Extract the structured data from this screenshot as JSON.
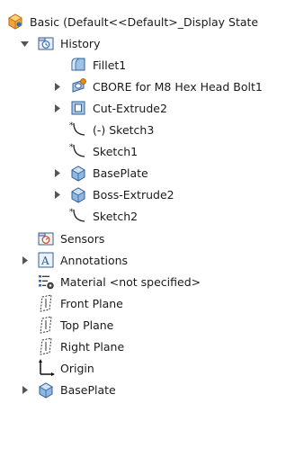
{
  "tree": {
    "root": {
      "label": "Basic  (Default<<Default>_Display State",
      "icon": "part-icon"
    },
    "history": {
      "label": "History",
      "icon": "history-folder-icon",
      "expanded": true,
      "items": [
        {
          "label": "Fillet1",
          "icon": "fillet-icon",
          "has_children": false
        },
        {
          "label": "CBORE for M8 Hex Head Bolt1",
          "icon": "hole-wizard-icon",
          "has_children": true
        },
        {
          "label": "Cut-Extrude2",
          "icon": "cut-extrude-icon",
          "has_children": true
        },
        {
          "label": "(-) Sketch3",
          "icon": "sketch-icon",
          "has_children": false
        },
        {
          "label": "Sketch1",
          "icon": "sketch-icon",
          "has_children": false
        },
        {
          "label": "BasePlate",
          "icon": "extrude-icon",
          "has_children": true
        },
        {
          "label": "Boss-Extrude2",
          "icon": "extrude-icon",
          "has_children": true
        },
        {
          "label": "Sketch2",
          "icon": "sketch-icon",
          "has_children": false
        }
      ]
    },
    "top_items": [
      {
        "label": "Sensors",
        "icon": "sensors-icon",
        "has_children": false
      },
      {
        "label": "Annotations",
        "icon": "annotations-icon",
        "has_children": true
      },
      {
        "label": "Material <not specified>",
        "icon": "material-icon",
        "has_children": false
      },
      {
        "label": "Front Plane",
        "icon": "plane-icon",
        "has_children": false
      },
      {
        "label": "Top Plane",
        "icon": "plane-icon",
        "has_children": false
      },
      {
        "label": "Right Plane",
        "icon": "plane-icon",
        "has_children": false
      },
      {
        "label": "Origin",
        "icon": "origin-icon",
        "has_children": false
      },
      {
        "label": "BasePlate",
        "icon": "extrude-icon",
        "has_children": true
      }
    ]
  },
  "colors": {
    "accent_orange": "#e88a1a",
    "accent_blue": "#2f6fb8",
    "toggle_gray": "#555555"
  }
}
